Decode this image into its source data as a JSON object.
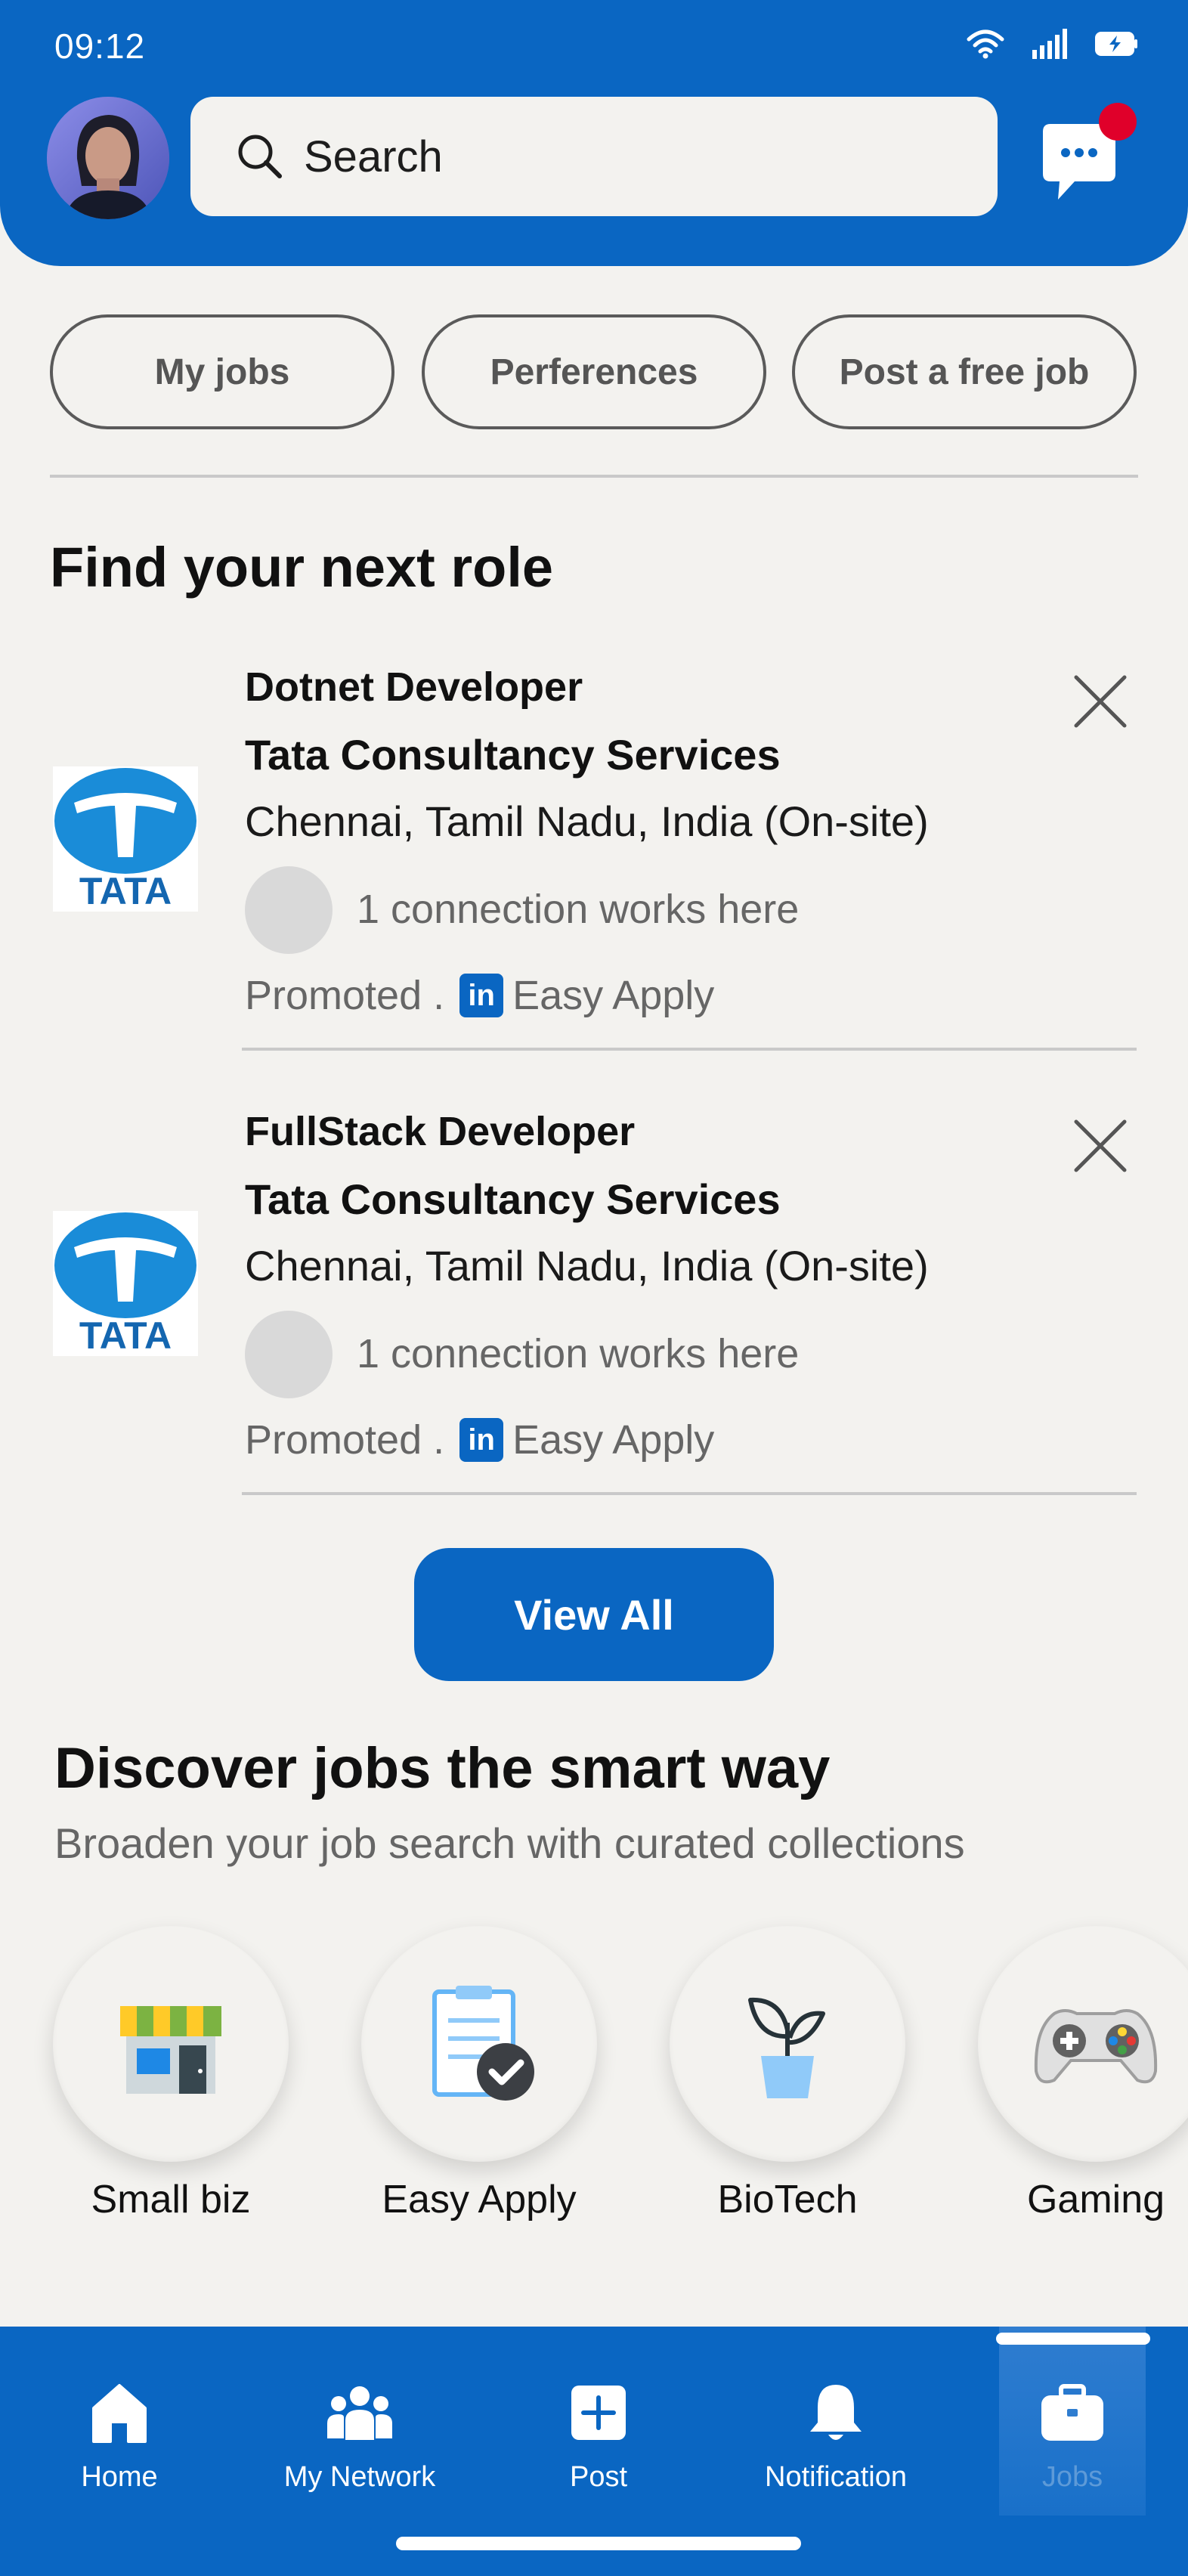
{
  "status_bar": {
    "time": "09:12"
  },
  "header": {
    "search_label": "Search"
  },
  "pills": [
    "My jobs",
    "Perferences",
    "Post a free job"
  ],
  "section_title": "Find your next role",
  "jobs": [
    {
      "title": "Dotnet  Developer",
      "company": "Tata Consultancy Services",
      "location": "Chennai, Tamil Nadu, India (On-site)",
      "connections": "1 connection works here",
      "promoted": "Promoted .",
      "easy_apply": "Easy Apply",
      "logo_text": "TATA"
    },
    {
      "title": "FullStack  Developer",
      "company": "Tata Consultancy Services",
      "location": "Chennai, Tamil Nadu, India (On-site)",
      "connections": "1 connection works here",
      "promoted": "Promoted .",
      "easy_apply": "Easy Apply",
      "logo_text": "TATA"
    }
  ],
  "view_all_label": "View All",
  "discover": {
    "title": "Discover jobs the smart way",
    "subtitle": "Broaden your job search with curated collections",
    "categories": [
      {
        "label": "Small biz",
        "icon": "shop-icon"
      },
      {
        "label": "Easy Apply",
        "icon": "clipboard-check-icon"
      },
      {
        "label": "BioTech",
        "icon": "plant-icon"
      },
      {
        "label": "Gaming",
        "icon": "gamepad-icon"
      }
    ]
  },
  "bottom_nav": {
    "items": [
      {
        "label": "Home",
        "icon": "home-icon"
      },
      {
        "label": "My Network",
        "icon": "network-icon"
      },
      {
        "label": "Post",
        "icon": "post-icon"
      },
      {
        "label": "Notification",
        "icon": "bell-icon"
      },
      {
        "label": "Jobs",
        "icon": "briefcase-icon",
        "active": true
      }
    ]
  },
  "colors": {
    "brand": "#0a66c2",
    "notification_dot": "#e0002a",
    "tata_blue": "#1a8cd8"
  }
}
